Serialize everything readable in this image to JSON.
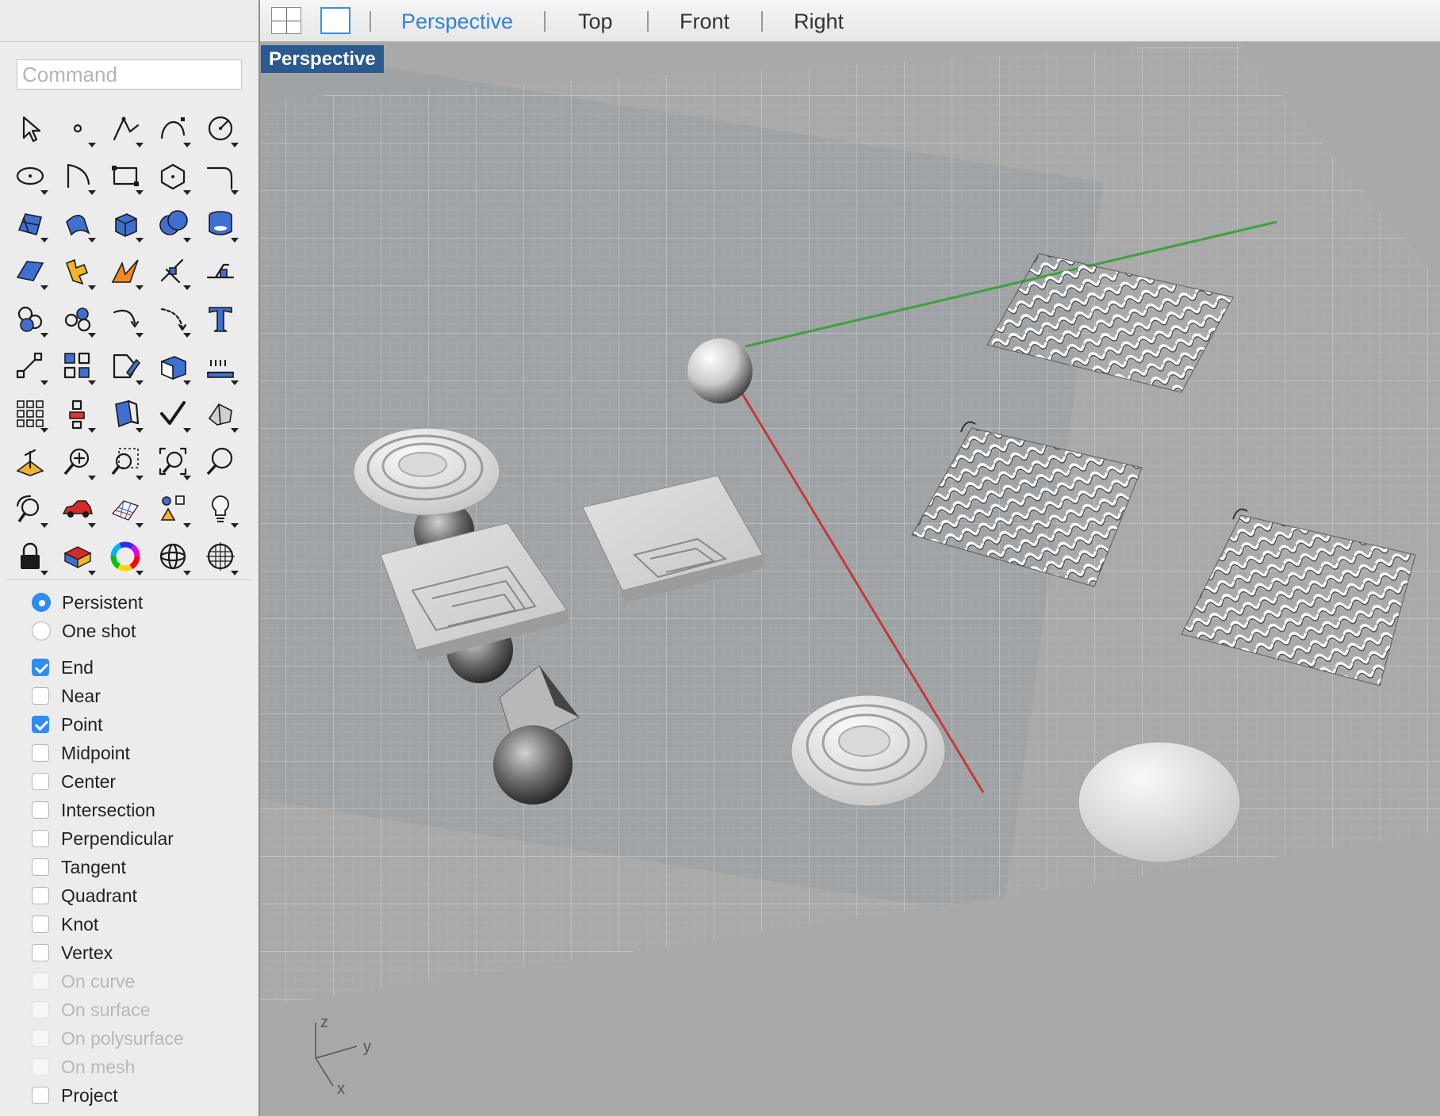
{
  "command": {
    "placeholder": "Command",
    "value": ""
  },
  "viewport_tabs": {
    "layout_buttons": [
      "four-viewports-icon",
      "single-viewport-icon"
    ],
    "tabs": [
      {
        "label": "Perspective",
        "active": true
      },
      {
        "label": "Top",
        "active": false
      },
      {
        "label": "Front",
        "active": false
      },
      {
        "label": "Right",
        "active": false
      }
    ]
  },
  "viewport": {
    "label": "Perspective",
    "axis_labels": {
      "z": "z",
      "y": "y",
      "x": "x"
    }
  },
  "tools": [
    "select-arrow-icon",
    "point-icon",
    "polyline-icon",
    "curve-icon",
    "circle-icon",
    "ellipse-icon",
    "arc-icon",
    "rectangle-icon",
    "polygon-icon",
    "fillet-curve-icon",
    "surface-from-points-icon",
    "surface-icon",
    "box-icon",
    "sphere-icon",
    "cylinder-icon",
    "plane-surface-icon",
    "explode-icon",
    "boolean-icon",
    "split-icon",
    "extrude-icon",
    "join-icon",
    "group-icon",
    "rotate-icon",
    "trim-icon",
    "text-icon",
    "scale-icon",
    "array-icon",
    "drafting-icon",
    "solid-tools-icon",
    "dimension-icon",
    "grid-array-icon",
    "align-icon",
    "transform-icon",
    "check-icon",
    "analyze-icon",
    "cplane-icon",
    "zoom-icon",
    "zoom-window-icon",
    "zoom-extents-icon",
    "zoom-selected-icon",
    "pan-icon",
    "car-render-icon",
    "mesh-icon",
    "properties-icon",
    "light-icon",
    "lock-icon",
    "layer-icon",
    "color-wheel-icon",
    "wireframe-sphere-icon",
    "mesh-sphere-icon"
  ],
  "osnap": {
    "mode": [
      {
        "label": "Persistent",
        "selected": true
      },
      {
        "label": "One shot",
        "selected": false
      }
    ],
    "snaps": [
      {
        "label": "End",
        "checked": true,
        "enabled": true
      },
      {
        "label": "Near",
        "checked": false,
        "enabled": true
      },
      {
        "label": "Point",
        "checked": true,
        "enabled": true
      },
      {
        "label": "Midpoint",
        "checked": false,
        "enabled": true
      },
      {
        "label": "Center",
        "checked": false,
        "enabled": true
      },
      {
        "label": "Intersection",
        "checked": false,
        "enabled": true
      },
      {
        "label": "Perpendicular",
        "checked": false,
        "enabled": true
      },
      {
        "label": "Tangent",
        "checked": false,
        "enabled": true
      },
      {
        "label": "Quadrant",
        "checked": false,
        "enabled": true
      },
      {
        "label": "Knot",
        "checked": false,
        "enabled": true
      },
      {
        "label": "Vertex",
        "checked": false,
        "enabled": true
      },
      {
        "label": "On curve",
        "checked": false,
        "enabled": false
      },
      {
        "label": "On surface",
        "checked": false,
        "enabled": false
      },
      {
        "label": "On polysurface",
        "checked": false,
        "enabled": false
      },
      {
        "label": "On mesh",
        "checked": false,
        "enabled": false
      },
      {
        "label": "Project",
        "checked": false,
        "enabled": true
      }
    ]
  },
  "colors": {
    "accent": "#2f8cf5",
    "viewport_background": "#a9a9a9",
    "grid_surface": "#9ea2a5",
    "x_axis": "#c43a3a",
    "y_axis": "#3da13d",
    "viewport_label_bg": "#2c5a8e"
  }
}
